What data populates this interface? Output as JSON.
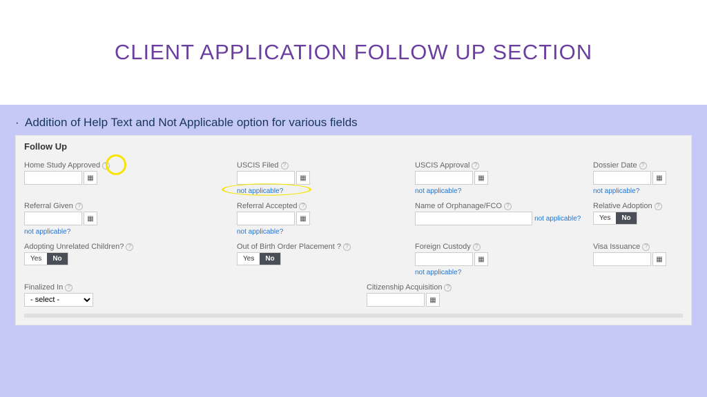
{
  "slide": {
    "title": "CLIENT APPLICATION FOLLOW UP SECTION",
    "bullet": "Addition of Help Text and Not Applicable option for various fields"
  },
  "panel": {
    "title": "Follow Up",
    "na_text": "not applicable?",
    "help_glyph": "?",
    "cal_glyph": "▦",
    "toggle_yes": "Yes",
    "toggle_no": "No",
    "select_placeholder": "- select -",
    "fields": {
      "home_study": "Home Study Approved",
      "uscis_filed": "USCIS Filed",
      "uscis_approval": "USCIS Approval",
      "dossier_date": "Dossier Date",
      "referral_given": "Referral Given",
      "referral_accepted": "Referral Accepted",
      "orphanage": "Name of Orphanage/FCO",
      "relative_adoption": "Relative Adoption",
      "adopt_unrelated": "Adopting Unrelated Children?",
      "out_birth_order": "Out of Birth Order Placement ?",
      "foreign_custody": "Foreign Custody",
      "visa_issuance": "Visa Issuance",
      "finalized_in": "Finalized In",
      "citizenship": "Citizenship Acquisition"
    }
  }
}
